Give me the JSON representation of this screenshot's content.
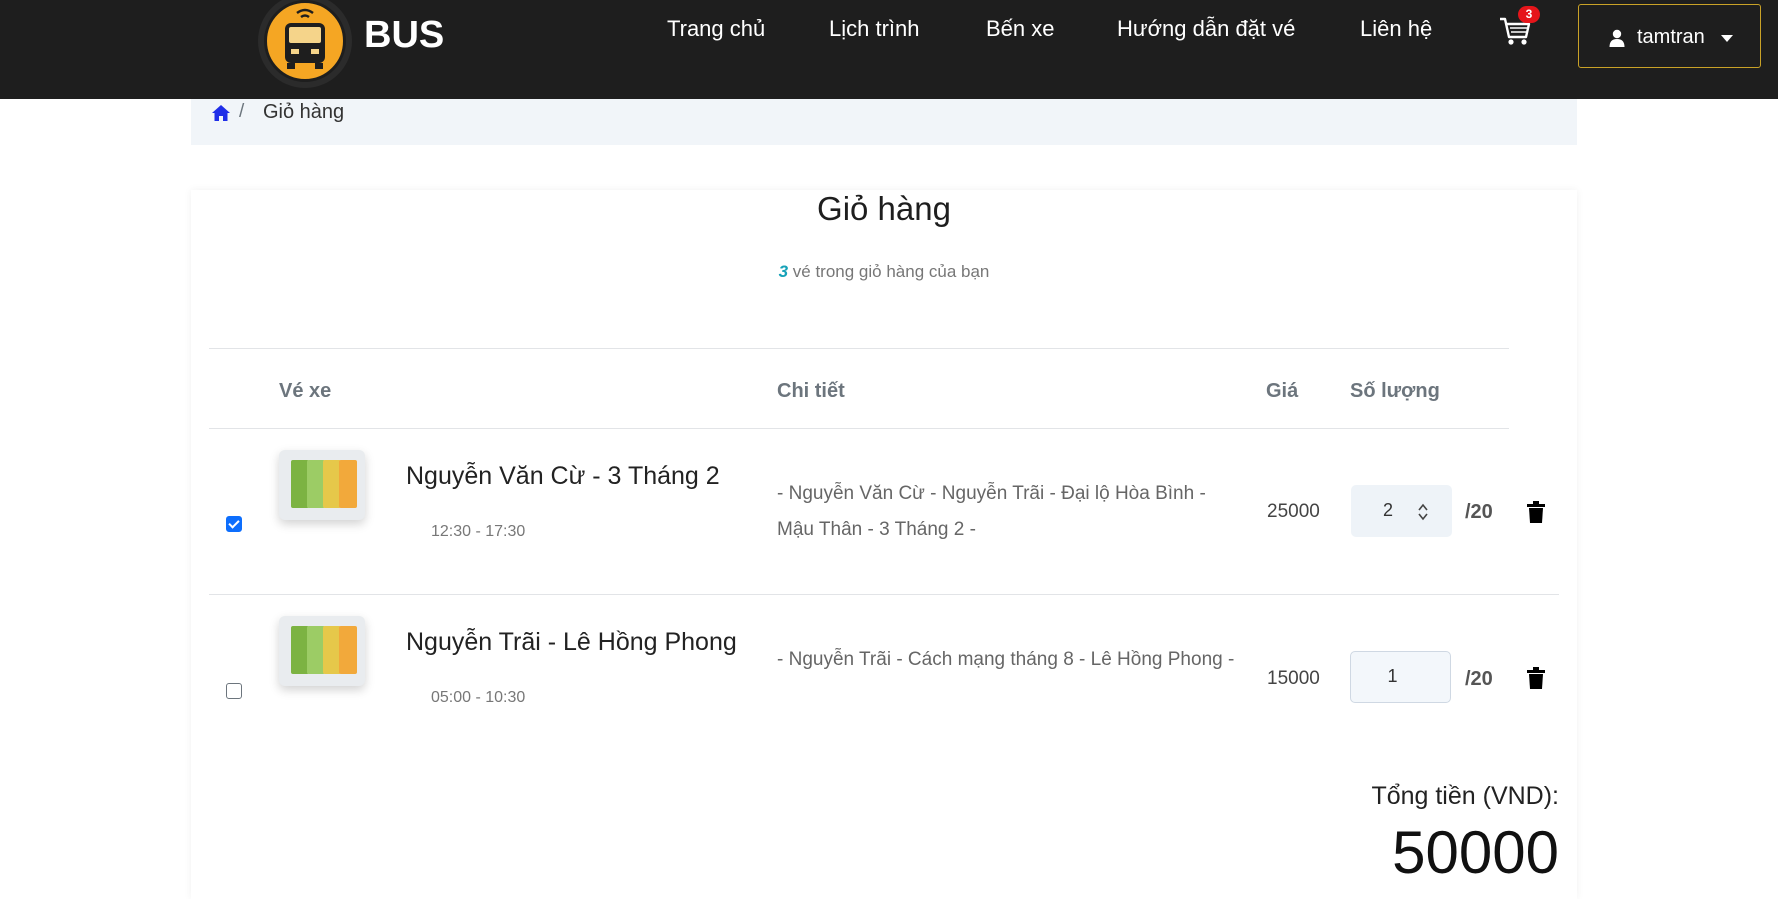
{
  "brand": "BUS",
  "nav": {
    "home": "Trang chủ",
    "schedule": "Lịch trình",
    "stations": "Bến xe",
    "guide": "Hướng dẫn đặt vé",
    "contact": "Liên hệ"
  },
  "cart_badge": "3",
  "user": {
    "name": "tamtran"
  },
  "breadcrumb": {
    "separator": "/",
    "current": "Giỏ hàng"
  },
  "cart": {
    "title": "Giỏ hàng",
    "count": "3",
    "count_suffix": " vé trong giỏ hàng của bạn",
    "headers": {
      "ticket": "Vé xe",
      "detail": "Chi tiết",
      "price": "Giá",
      "quantity": "Số lượng"
    },
    "items": [
      {
        "checked": true,
        "route": "Nguyễn Văn Cừ - 3 Tháng 2",
        "time": "12:30 - 17:30",
        "detail": "- Nguyễn Văn Cừ - Nguyễn Trãi - Đại lộ Hòa Bình - Mậu Thân - 3 Tháng 2 -",
        "price": "25000",
        "quantity": "2",
        "max": "/20"
      },
      {
        "checked": false,
        "route": "Nguyễn Trãi - Lê Hồng Phong",
        "time": "05:00 - 10:30",
        "detail": "- Nguyễn Trãi - Cách mạng tháng 8 - Lê Hồng Phong -",
        "price": "15000",
        "quantity": "1",
        "max": "/20"
      }
    ],
    "total_label": "Tổng tiền (VND):",
    "total_value": "50000"
  },
  "colors": {
    "navbar": "#1e1e1e",
    "accent_border": "#c9a227",
    "badge": "#e5151a",
    "count_highlight": "#17a2b8",
    "checkbox": "#0d6efd"
  },
  "icons": [
    "bus-logo-icon",
    "cart-icon",
    "user-icon",
    "caret-down-icon",
    "home-icon",
    "spinner-icon",
    "trash-icon"
  ]
}
